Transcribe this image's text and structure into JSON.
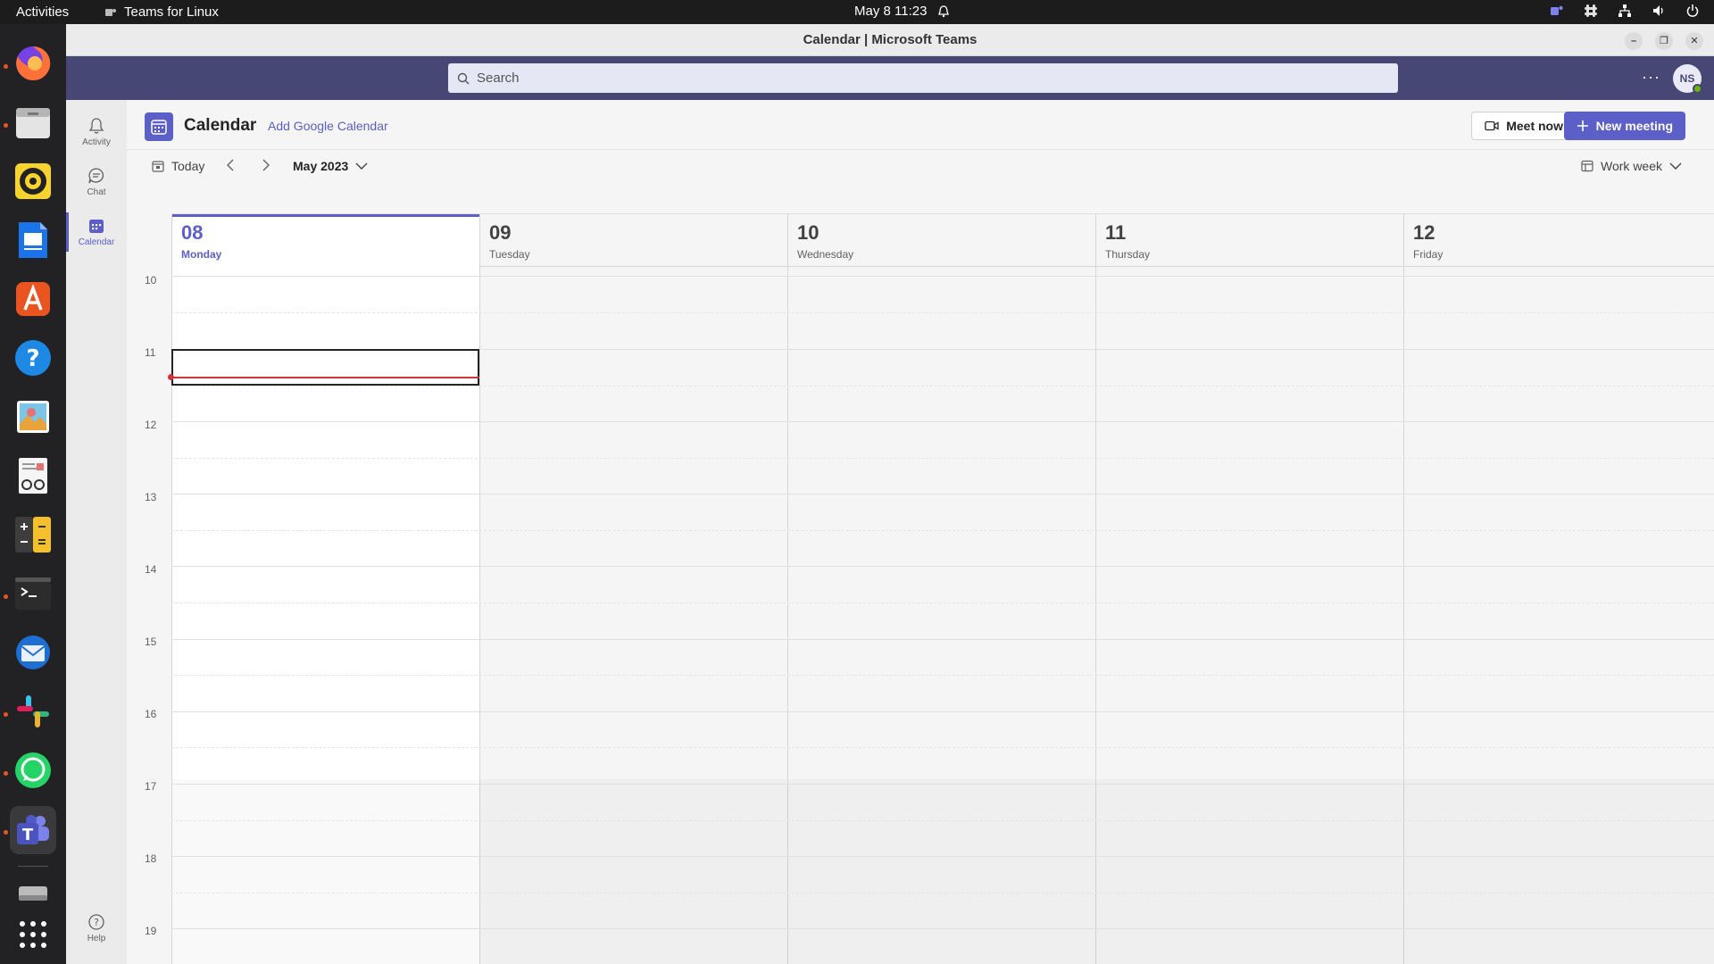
{
  "topbar": {
    "activities": "Activities",
    "app_name": "Teams for Linux",
    "clock": "May 8  11:23"
  },
  "window": {
    "title": "Calendar | Microsoft Teams"
  },
  "teams_bar": {
    "search_placeholder": "Search",
    "avatar_initials": "NS"
  },
  "rail": {
    "items": [
      {
        "label": "Activity",
        "icon": "bell-icon"
      },
      {
        "label": "Chat",
        "icon": "chat-icon"
      },
      {
        "label": "Calendar",
        "icon": "calendar-icon",
        "active": true
      },
      {
        "label": "Help",
        "icon": "help-icon"
      }
    ]
  },
  "calendar_header": {
    "title": "Calendar",
    "add_google": "Add Google Calendar",
    "meet_now": "Meet now",
    "new_meeting": "New meeting"
  },
  "calendar_nav": {
    "today": "Today",
    "month": "May 2023",
    "view": "Work week"
  },
  "days": [
    {
      "num": "08",
      "name": "Monday",
      "today": true
    },
    {
      "num": "09",
      "name": "Tuesday"
    },
    {
      "num": "10",
      "name": "Wednesday"
    },
    {
      "num": "11",
      "name": "Thursday"
    },
    {
      "num": "12",
      "name": "Friday"
    }
  ],
  "hours": [
    "10",
    "11",
    "12",
    "13",
    "14",
    "15",
    "16",
    "17",
    "18",
    "19"
  ],
  "colors": {
    "accent": "#5b5fc7",
    "teams_header": "#464775",
    "now_line": "#d13438",
    "ubuntu_orange": "#e95420"
  },
  "dock": {
    "apps": [
      "firefox-icon",
      "files-icon",
      "rhythmbox-icon",
      "writer-icon",
      "app-center-icon",
      "help-icon",
      "image-viewer-icon",
      "document-viewer-icon",
      "calculator-icon",
      "terminal-icon",
      "thunderbird-icon",
      "slack-icon",
      "whatsapp-icon",
      "teams-icon",
      "drive-icon",
      "show-apps-icon"
    ]
  }
}
